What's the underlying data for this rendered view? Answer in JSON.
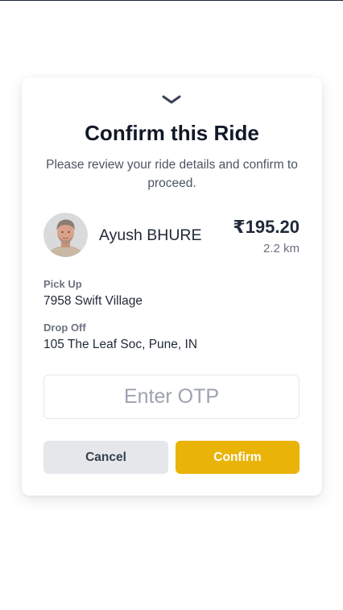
{
  "modal": {
    "title": "Confirm this Ride",
    "subtitle": "Please review your ride details and confirm to proceed.",
    "collapse_icon": "chevron-down-icon"
  },
  "driver": {
    "name": "Ayush BHURE",
    "avatar": "driver-avatar-photo"
  },
  "ride": {
    "fare": "₹195.20",
    "distance": "2.2 km",
    "pickup_label": "Pick Up",
    "pickup_value": "7958 Swift Village",
    "dropoff_label": "Drop Off",
    "dropoff_value": "105 The Leaf Soc, Pune, IN"
  },
  "otp": {
    "placeholder": "Enter OTP",
    "value": ""
  },
  "actions": {
    "cancel_label": "Cancel",
    "confirm_label": "Confirm"
  },
  "colors": {
    "accent": "#eab308",
    "title": "#111827",
    "muted": "#6b7280",
    "cancel_bg": "#e5e7eb"
  }
}
